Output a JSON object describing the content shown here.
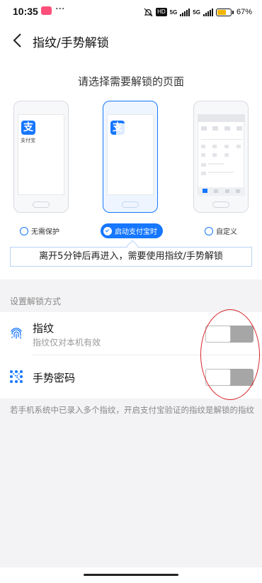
{
  "status_bar": {
    "time": "10:35",
    "dots": "···",
    "hd_label": "HD",
    "net1": "5G",
    "net2": "5G",
    "battery": "67%"
  },
  "header": {
    "title": "指纹/手势解锁"
  },
  "selection": {
    "prompt": "请选择需要解锁的页面",
    "phone_caption": "支付宝",
    "logo_char": "支",
    "options": [
      {
        "label": "无需保护",
        "selected": false
      },
      {
        "label": "启动支付宝时",
        "selected": true
      },
      {
        "label": "自定义",
        "selected": false
      }
    ],
    "tip": "离开5分钟后再进入，需要使用指纹/手势解锁"
  },
  "unlock": {
    "section_label": "设置解锁方式",
    "items": [
      {
        "title": "指纹",
        "subtitle": "指纹仅对本机有效",
        "icon": "fingerprint-icon",
        "enabled": false
      },
      {
        "title": "手势密码",
        "subtitle": "",
        "icon": "gesture-icon",
        "enabled": false
      }
    ],
    "footnote": "若手机系统中已录入多个指纹，开启支付宝验证的指纹是解锁的指纹"
  },
  "colors": {
    "accent": "#1677ff",
    "annotation": "#d8262b",
    "toggle_off": "#a6a6a6"
  }
}
